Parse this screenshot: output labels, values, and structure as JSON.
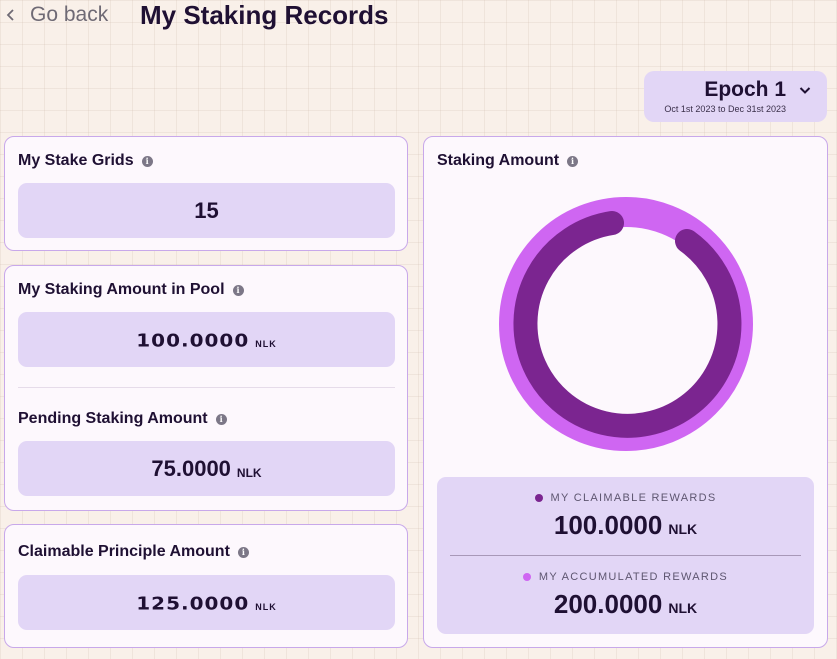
{
  "header": {
    "back_label": "Go back",
    "title": "My Staking Records"
  },
  "epoch": {
    "name": "Epoch 1",
    "dates": "Oct 1st 2023 to Dec 31st 2023"
  },
  "cards": {
    "stake_grids": {
      "label": "My Stake Grids",
      "value": "15"
    },
    "staking_in_pool": {
      "label": "My Staking Amount in Pool",
      "value": "100.0000",
      "unit": "NLK"
    },
    "pending": {
      "label": "Pending Staking Amount",
      "value": "75.0000",
      "unit": "NLK"
    },
    "claimable_principle": {
      "label": "Claimable Principle Amount",
      "value": "125.0000",
      "unit": "NLK"
    }
  },
  "staking_amount": {
    "label": "Staking Amount",
    "claimable": {
      "label": "MY CLAIMABLE REWARDS",
      "value": "100.0000",
      "unit": "NLK",
      "color": "#7b2590"
    },
    "accumulated": {
      "label": "MY ACCUMULATED REWARDS",
      "value": "200.0000",
      "unit": "NLK",
      "color": "#cf66f2"
    }
  },
  "colors": {
    "accent_dark": "#7b2590",
    "accent_light": "#cf66f2",
    "panel": "#e2d6f6",
    "border": "#c8a8ea"
  }
}
